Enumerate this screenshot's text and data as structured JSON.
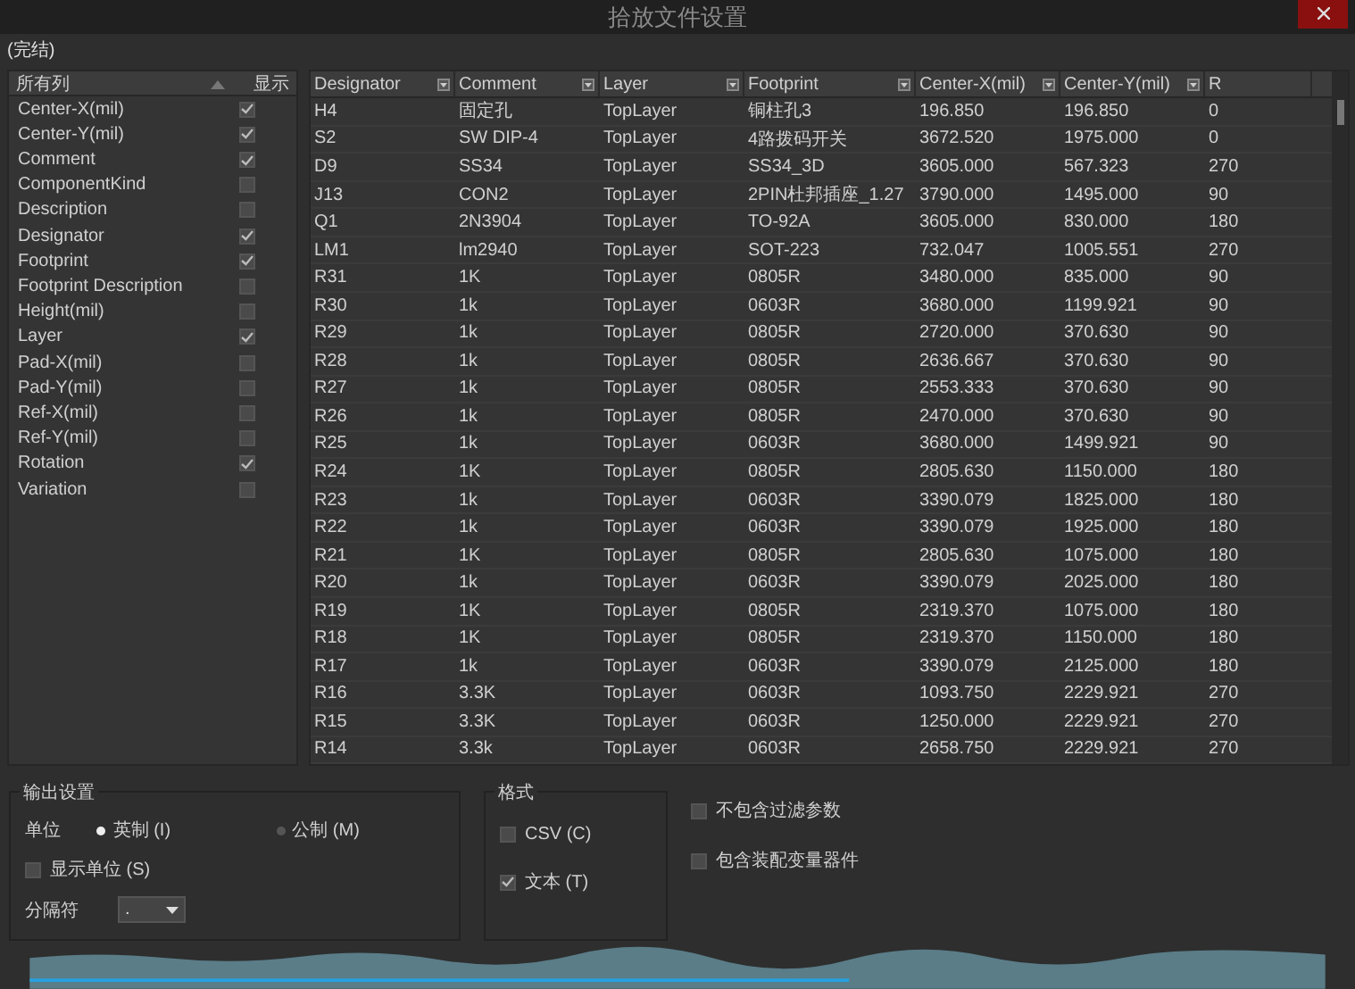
{
  "window": {
    "title": "拾放文件设置"
  },
  "status": "(完结)",
  "columns_panel": {
    "header": "所有列",
    "show_header": "显示",
    "items": [
      {
        "label": "Center-X(mil)",
        "checked": true
      },
      {
        "label": "Center-Y(mil)",
        "checked": true
      },
      {
        "label": "Comment",
        "checked": true
      },
      {
        "label": "ComponentKind",
        "checked": false
      },
      {
        "label": "Description",
        "checked": false
      },
      {
        "label": "Designator",
        "checked": true
      },
      {
        "label": "Footprint",
        "checked": true
      },
      {
        "label": "Footprint Description",
        "checked": false
      },
      {
        "label": "Height(mil)",
        "checked": false
      },
      {
        "label": "Layer",
        "checked": true
      },
      {
        "label": "Pad-X(mil)",
        "checked": false
      },
      {
        "label": "Pad-Y(mil)",
        "checked": false
      },
      {
        "label": "Ref-X(mil)",
        "checked": false
      },
      {
        "label": "Ref-Y(mil)",
        "checked": false
      },
      {
        "label": "Rotation",
        "checked": true
      },
      {
        "label": "Variation",
        "checked": false
      }
    ]
  },
  "table": {
    "columns": [
      "Designator",
      "Comment",
      "Layer",
      "Footprint",
      "Center-X(mil)",
      "Center-Y(mil)",
      "R"
    ],
    "rows": [
      [
        "H4",
        "固定孔",
        "TopLayer",
        "铜柱孔3",
        "196.850",
        "196.850",
        "0"
      ],
      [
        "S2",
        "SW DIP-4",
        "TopLayer",
        "4路拨码开关",
        "3672.520",
        "1975.000",
        "0"
      ],
      [
        "D9",
        "SS34",
        "TopLayer",
        "SS34_3D",
        "3605.000",
        "567.323",
        "270"
      ],
      [
        "J13",
        "CON2",
        "TopLayer",
        "2PIN杜邦插座_1.27",
        "3790.000",
        "1495.000",
        "90"
      ],
      [
        "Q1",
        "2N3904",
        "TopLayer",
        "TO-92A",
        "3605.000",
        "830.000",
        "180"
      ],
      [
        "LM1",
        "lm2940",
        "TopLayer",
        "SOT-223",
        "732.047",
        "1005.551",
        "270"
      ],
      [
        "R31",
        "1K",
        "TopLayer",
        "0805R",
        "3480.000",
        "835.000",
        "90"
      ],
      [
        "R30",
        "1k",
        "TopLayer",
        "0603R",
        "3680.000",
        "1199.921",
        "90"
      ],
      [
        "R29",
        "1k",
        "TopLayer",
        "0805R",
        "2720.000",
        "370.630",
        "90"
      ],
      [
        "R28",
        "1k",
        "TopLayer",
        "0805R",
        "2636.667",
        "370.630",
        "90"
      ],
      [
        "R27",
        "1k",
        "TopLayer",
        "0805R",
        "2553.333",
        "370.630",
        "90"
      ],
      [
        "R26",
        "1k",
        "TopLayer",
        "0805R",
        "2470.000",
        "370.630",
        "90"
      ],
      [
        "R25",
        "1k",
        "TopLayer",
        "0603R",
        "3680.000",
        "1499.921",
        "90"
      ],
      [
        "R24",
        "1K",
        "TopLayer",
        "0805R",
        "2805.630",
        "1150.000",
        "180"
      ],
      [
        "R23",
        "1k",
        "TopLayer",
        "0603R",
        "3390.079",
        "1825.000",
        "180"
      ],
      [
        "R22",
        "1k",
        "TopLayer",
        "0603R",
        "3390.079",
        "1925.000",
        "180"
      ],
      [
        "R21",
        "1K",
        "TopLayer",
        "0805R",
        "2805.630",
        "1075.000",
        "180"
      ],
      [
        "R20",
        "1k",
        "TopLayer",
        "0603R",
        "3390.079",
        "2025.000",
        "180"
      ],
      [
        "R19",
        "1K",
        "TopLayer",
        "0805R",
        "2319.370",
        "1075.000",
        "180"
      ],
      [
        "R18",
        "1K",
        "TopLayer",
        "0805R",
        "2319.370",
        "1150.000",
        "180"
      ],
      [
        "R17",
        "1k",
        "TopLayer",
        "0603R",
        "3390.079",
        "2125.000",
        "180"
      ],
      [
        "R16",
        "3.3K",
        "TopLayer",
        "0603R",
        "1093.750",
        "2229.921",
        "270"
      ],
      [
        "R15",
        "3.3K",
        "TopLayer",
        "0603R",
        "1250.000",
        "2229.921",
        "270"
      ],
      [
        "R14",
        "3.3k",
        "TopLayer",
        "0603R",
        "2658.750",
        "2229.921",
        "270"
      ]
    ]
  },
  "output_settings": {
    "title": "输出设置",
    "unit_label": "单位",
    "units": [
      {
        "label": "英制 (I)",
        "selected": true
      },
      {
        "label": "公制 (M)",
        "selected": false
      }
    ],
    "show_units": {
      "label": "显示单位 (S)",
      "checked": false
    },
    "separator": {
      "label": "分隔符",
      "value": "."
    }
  },
  "format": {
    "title": "格式",
    "options": [
      {
        "label": "CSV (C)",
        "checked": false
      },
      {
        "label": "文本 (T)",
        "checked": true
      }
    ]
  },
  "options": [
    {
      "label": "不包含过滤参数",
      "checked": false
    },
    {
      "label": "包含装配变量器件",
      "checked": false
    }
  ]
}
